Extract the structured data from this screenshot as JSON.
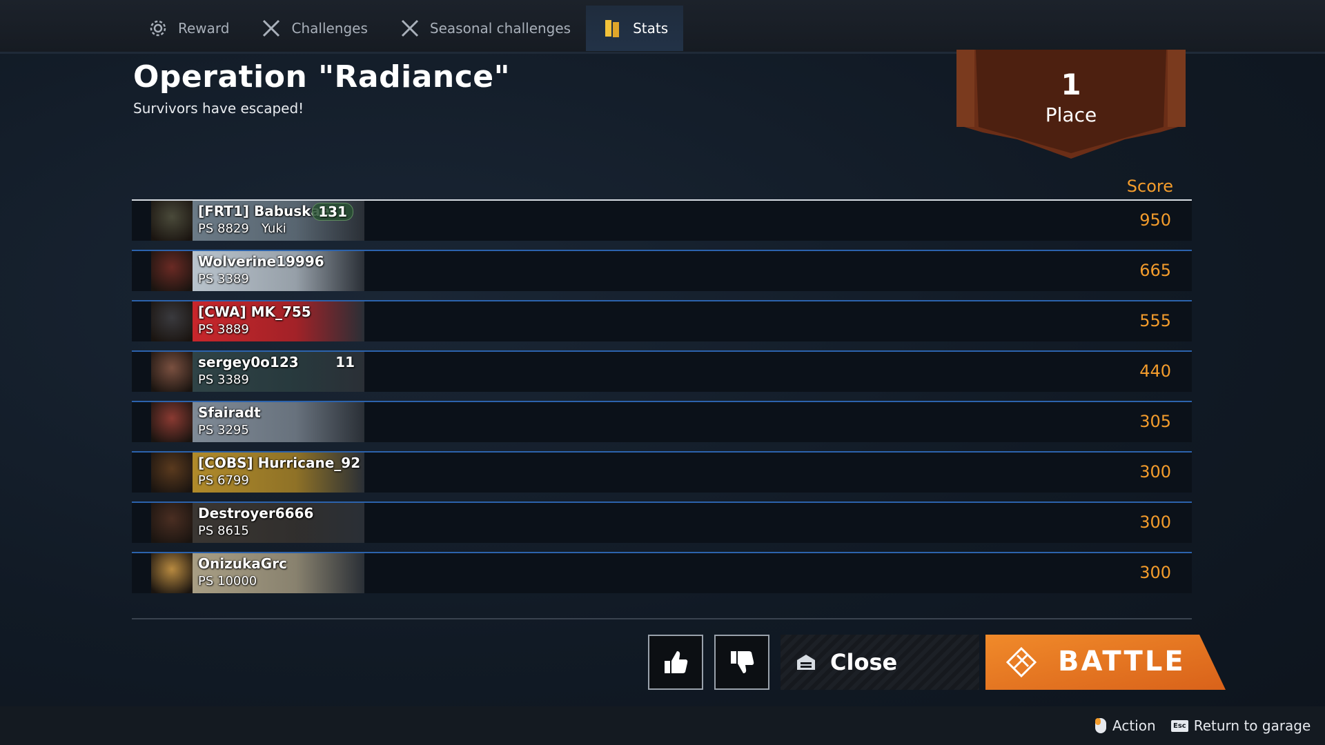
{
  "tabs": [
    {
      "label": "Reward",
      "icon": "gear-badge-icon",
      "active": false
    },
    {
      "label": "Challenges",
      "icon": "crossed-swords-icon",
      "active": false
    },
    {
      "label": "Seasonal challenges",
      "icon": "crossed-swords-icon",
      "active": false
    },
    {
      "label": "Stats",
      "icon": "stats-book-icon",
      "active": true
    }
  ],
  "header": {
    "title": "Operation \"Radiance\"",
    "subtitle": "Survivors have escaped!"
  },
  "place": {
    "number": "1",
    "label": "Place"
  },
  "table": {
    "score_header": "Score",
    "rows": [
      {
        "clan": "[FRT1]",
        "name": "[FRT1] Babuskae",
        "ps": "PS 8829",
        "extra": "Yuki",
        "level": "131",
        "score": "950",
        "plate": "#6b7a86",
        "avatar": "#4a4a3a"
      },
      {
        "clan": "",
        "name": "Wolverine19996",
        "ps": "PS 3389",
        "extra": "",
        "level": "",
        "score": "665",
        "plate": "#b9c3cc",
        "avatar": "#6a2a24"
      },
      {
        "clan": "[CWA]",
        "name": "[CWA] MK_755",
        "ps": "PS 3889",
        "extra": "",
        "level": "",
        "score": "555",
        "plate": "#c8262b",
        "avatar": "#3a3a3e"
      },
      {
        "clan": "",
        "name": "sergey0o123",
        "ps": "PS 3389",
        "extra": "",
        "level": "11",
        "score": "440",
        "plate": "#2f4346",
        "avatar": "#7a5040"
      },
      {
        "clan": "",
        "name": "Sfairadt",
        "ps": "PS 3295",
        "extra": "",
        "level": "",
        "score": "305",
        "plate": "#7f8a96",
        "avatar": "#8a3a32"
      },
      {
        "clan": "[COBS]",
        "name": "[COBS] Hurricane_92",
        "ps": "PS 6799",
        "extra": "",
        "level": "",
        "score": "300",
        "plate": "#b08a2a",
        "avatar": "#5a3a1e"
      },
      {
        "clan": "",
        "name": "Destroyer6666",
        "ps": "PS 8615",
        "extra": "",
        "level": "",
        "score": "300",
        "plate": "#3a3632",
        "avatar": "#4a2e22"
      },
      {
        "clan": "",
        "name": "OnizukaGrc",
        "ps": "PS 10000",
        "extra": "",
        "level": "",
        "score": "300",
        "plate": "#a89e84",
        "avatar": "#b88a40"
      }
    ]
  },
  "buttons": {
    "like": "thumbs-up-icon",
    "dislike": "thumbs-down-icon",
    "close": "Close",
    "battle": "BATTLE"
  },
  "footer": {
    "action": "Action",
    "return": "Return to garage",
    "esc_key": "Esc"
  },
  "colors": {
    "accent": "#f39c2c",
    "battle": "#e9761c",
    "row_border": "#2c63ad"
  }
}
